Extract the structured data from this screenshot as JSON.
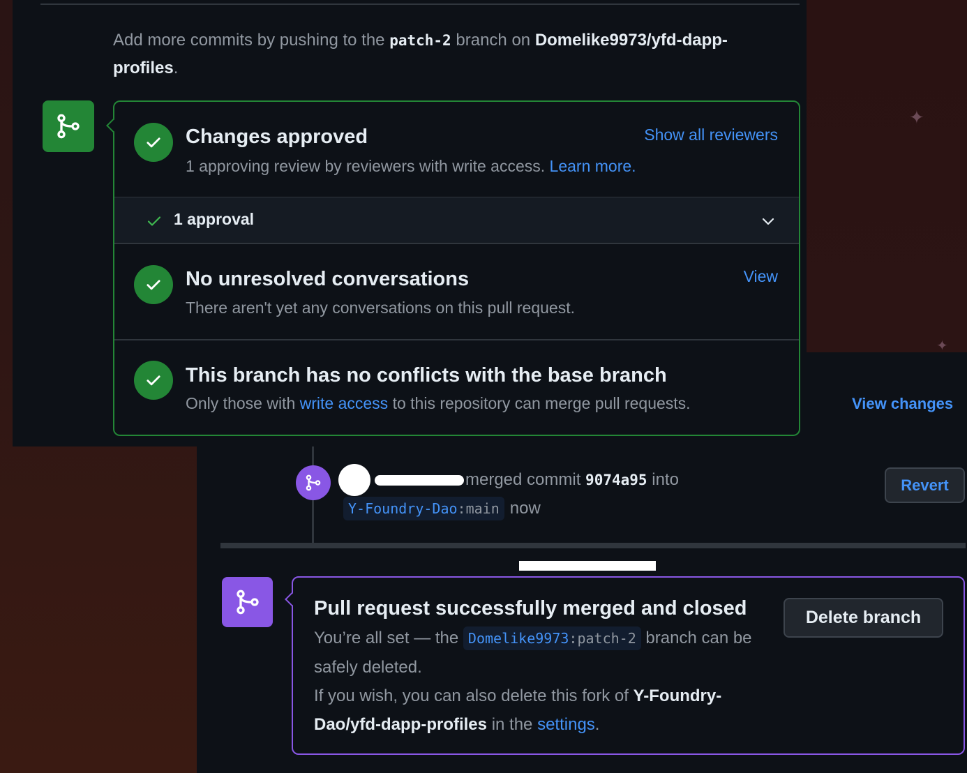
{
  "intro": {
    "prefix": "Add more commits by pushing to the",
    "branch": "patch-2",
    "middle": "branch on",
    "repo": "Domelike9973/yfd-dapp-profiles",
    "suffix": "."
  },
  "checks": [
    {
      "title": "Changes approved",
      "description": "1 approving review by reviewers with write access.",
      "description_link": "Learn more.",
      "action_link": "Show all reviewers"
    },
    {
      "title": "No unresolved conversations",
      "description": "There aren't yet any conversations on this pull request.",
      "action_link": "View"
    },
    {
      "title": "This branch has no conflicts with the base branch",
      "description_prefix": "Only those with",
      "description_link": "write access",
      "description_suffix": "to this repository can merge pull requests."
    }
  ],
  "approvals": {
    "label": "1 approval"
  },
  "view_changes": "View changes",
  "merge_event": {
    "action": "merged commit",
    "commit": "9074a95",
    "into": "into",
    "target_owner": "Y-Foundry-Dao",
    "target_sep": ":",
    "target_branch": "main",
    "time": "now",
    "revert_label": "Revert"
  },
  "merged_box": {
    "title": "Pull request successfully merged and closed",
    "line1_prefix": "You’re all set — the",
    "branch_owner": "Domelike9973",
    "branch_sep": ":",
    "branch_name": "patch-2",
    "line1_suffix": "branch can be safely deleted.",
    "line2_prefix": "If you wish, you can also delete this fork of",
    "line2_repo": "Y-Foundry-Dao/yfd-dapp-profiles",
    "line2_mid": "in the",
    "line2_link": "settings",
    "line2_suffix": ".",
    "delete_label": "Delete branch"
  },
  "colors": {
    "success": "#238636",
    "merged": "#8957e5",
    "link": "#4493f8",
    "canvas": "#0d1117"
  }
}
